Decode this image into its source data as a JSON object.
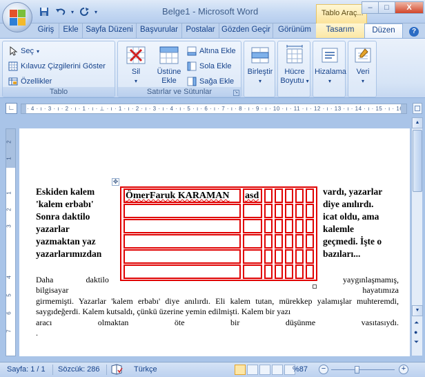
{
  "window": {
    "title": "Belge1 - Microsoft Word",
    "context_tab": "Tablo Araç...",
    "min_label": "–",
    "max_label": "□",
    "close_label": "X"
  },
  "quick_access": {
    "save_icon": "save-icon",
    "undo_icon": "undo-icon",
    "redo_icon": "redo-icon",
    "customize": "▾"
  },
  "tabs": [
    "Giriş",
    "Ekle",
    "Sayfa Düzeni",
    "Başvurular",
    "Postalar",
    "Gözden Geçir",
    "Görünüm",
    "Tasarım",
    "Düzen"
  ],
  "ribbon": {
    "tablo": {
      "label": "Tablo",
      "sec": "Seç",
      "kilavuz": "Kılavuz Çizgilerini Göster",
      "ozellikler": "Özellikler"
    },
    "satirlar": {
      "label": "Satırlar ve Sütunlar",
      "sil": "Sil",
      "ustune_ekle_1": "Üstüne",
      "ustune_ekle_2": "Ekle",
      "altina": "Altına Ekle",
      "sola": "Sola Ekle",
      "saga": "Sağa Ekle"
    },
    "birlestir": "Birleştir",
    "hucre_1": "Hücre",
    "hucre_2": "Boyutu",
    "hizalama": "Hizalama",
    "veri": "Veri",
    "help": "?"
  },
  "ruler": {
    "marks": "· 4 · ı · 3 · ı · 2 · ı · 1 · ı · ⊥ · ı · 1 · ı · 2 · ı · 3 · ı · 4 · ı · 5 · ı · 6 · ı · 7 · ı · 8 · ı · 9 · ı · 10 · ı · 11 · ı · 12 · ı · 13 · ı · 14 · ı · 15 · ı · 16"
  },
  "document": {
    "left_column": "Eskiden kalem\n'kalem erbabı'\nSonra daktilo\nyazarlar\nyazmaktan yaz\nyazarlarımızdan",
    "right_column": "vardı, yazarlar\ndiye anılırdı.\nicat oldu, ama\nkalemle\ngeçmedi. İşte o\nbazıları...",
    "table": {
      "cell_name": "ÖmerFaruk KARAMAN",
      "cell_asd": "asd",
      "rows": 6,
      "cols": 7
    },
    "body_line1_a": "Daha",
    "body_line1_b": "daktilo",
    "body_line1_c": "yaygınlaşmamış,",
    "body_line2_a": "bilgisayar",
    "body_line2_b": "hayatımıza",
    "body_rest": "girmemişti. Yazarlar 'kalem erbabı' diye anılırdı. Eli kalem tutan, mürekkep yalamışlar muhteremdi, saygıdeğerdi. Kalem kutsaldı, çünkü üzerine yemin edilmişti. Kalem bir yazı",
    "body_last_words": [
      "aracı",
      "olmaktan",
      "öte",
      "bir",
      "düşünme",
      "vasıtasıydı."
    ],
    "body_end": "."
  },
  "statusbar": {
    "page": "Sayfa: 1 / 1",
    "words": "Sözcük: 286",
    "language": "Türkçe",
    "zoom": "%87",
    "zoom_percent": 87
  },
  "colors": {
    "table_border": "#e00000",
    "ribbon_text": "#15428b"
  }
}
